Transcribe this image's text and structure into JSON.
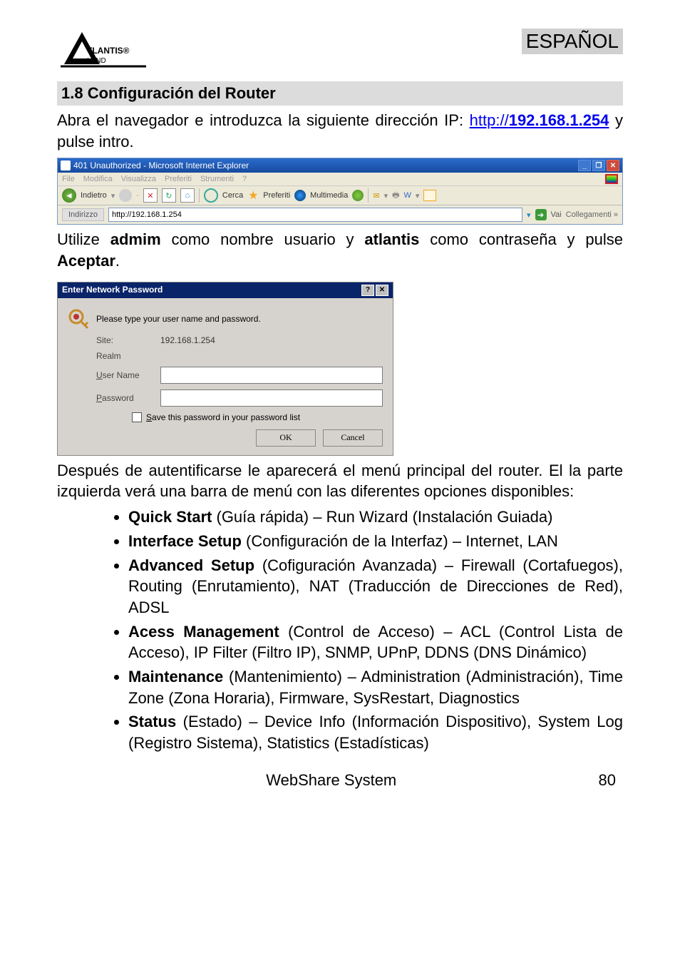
{
  "header": {
    "logo_text": "ATLANTIS",
    "logo_sub": "LAND",
    "language_label": "ESPAÑOL"
  },
  "section": {
    "title": "1.8 Configuración del Router",
    "intro_pre": "Abra el navegador e introduzca la siguiente dirección IP: ",
    "intro_link_prefix": "http://",
    "intro_link_ip": "192.168.1.254",
    "intro_post": " y pulse intro."
  },
  "ie": {
    "title": "401 Unauthorized - Microsoft Internet Explorer",
    "menu": {
      "file": "File",
      "modifica": "Modifica",
      "visualizza": "Visualizza",
      "preferiti": "Preferiti",
      "strumenti": "Strumenti",
      "help": "?"
    },
    "toolbar": {
      "indietro": "Indietro",
      "cerca": "Cerca",
      "preferiti": "Preferiti",
      "multimedia": "Multimedia"
    },
    "address_label": "Indirizzo",
    "address_value": "http://192.168.1.254",
    "go_label": "Vai",
    "links_label": "Collegamenti »"
  },
  "creds_para": {
    "pre": "Utilize ",
    "admin": "admim",
    "mid1": " como nombre usuario y ",
    "pwd": "atlantis",
    "mid2": " como contraseña y pulse ",
    "accept": "Aceptar",
    "end": "."
  },
  "pw": {
    "title": "Enter Network Password",
    "instruction": "Please type your user name and password.",
    "site_label": "Site:",
    "site_value": "192.168.1.254",
    "realm_label": "Realm",
    "user_label_pre": "U",
    "user_label_post": "ser Name",
    "pass_label_pre": "P",
    "pass_label_post": "assword",
    "save_pre": "S",
    "save_post": "ave this password in your password list",
    "ok": "OK",
    "cancel": "Cancel"
  },
  "after_para": "Después de autentificarse le aparecerá el menú principal del router. El la parte izquierda verá una barra de menú con las diferentes opciones disponibles:",
  "menu_items": [
    {
      "bold": "Quick Start",
      "rest": " (Guía rápida) – Run Wizard (Instalación Guiada)"
    },
    {
      "bold": "Interface Setup",
      "rest": " (Configuración de la Interfaz) – Internet, LAN"
    },
    {
      "bold": "Advanced Setup",
      "rest": " (Cofiguración Avanzada) – Firewall (Cortafuegos), Routing (Enrutamiento), NAT (Traducción de Direcciones de Red), ADSL"
    },
    {
      "bold": "Acess Management",
      "rest": " (Control de Acceso) – ACL (Control Lista de Acceso), IP Filter (Filtro IP), SNMP, UPnP, DDNS (DNS Dinámico)"
    },
    {
      "bold": "Maintenance",
      "rest": " (Mantenimiento) – Administration (Administración), Time Zone (Zona Horaria), Firmware, SysRestart, Diagnostics"
    },
    {
      "bold": "Status",
      "rest": " (Estado) – Device Info (Información Dispositivo), System Log (Registro Sistema), Statistics (Estadísticas)"
    }
  ],
  "footer": {
    "product": "WebShare System",
    "page": "80"
  }
}
